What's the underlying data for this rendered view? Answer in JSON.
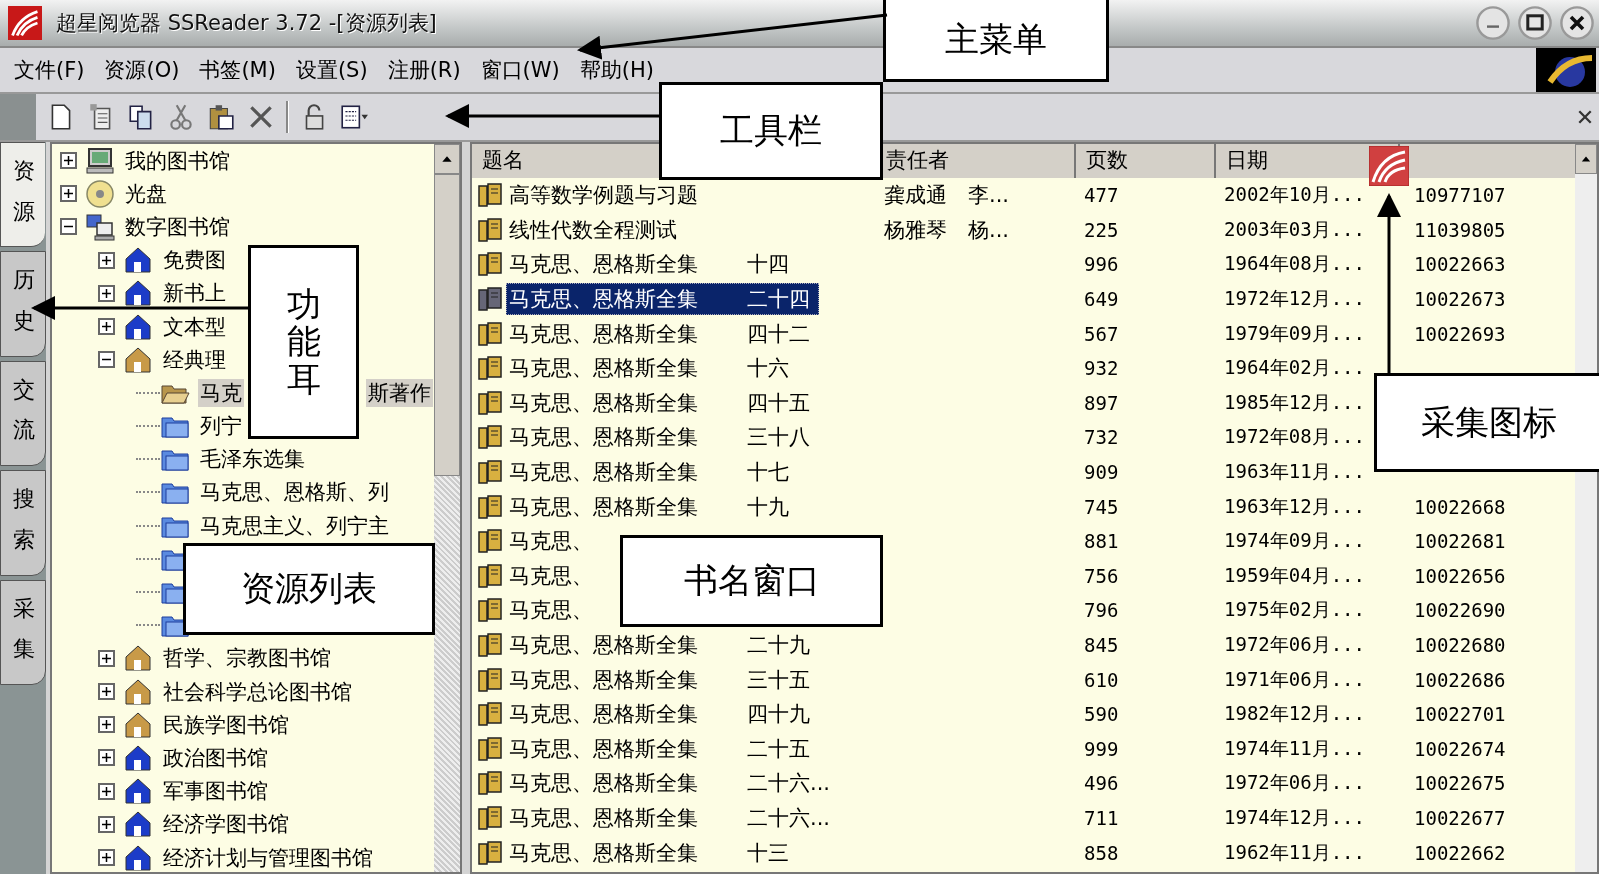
{
  "window": {
    "title": "超星阅览器 SSReader 3.72 -[资源列表]"
  },
  "menu": [
    "文件(F)",
    "资源(O)",
    "书签(M)",
    "设置(S)",
    "注册(R)",
    "窗口(W)",
    "帮助(H)"
  ],
  "side_tabs": [
    {
      "label": "资源",
      "selected": true
    },
    {
      "label": "历史",
      "selected": false
    },
    {
      "label": "交流",
      "selected": false
    },
    {
      "label": "搜索",
      "selected": false
    },
    {
      "label": "采集",
      "selected": false
    }
  ],
  "tree": [
    {
      "label": "我的图书馆",
      "kind": "pc",
      "expanded": false,
      "selected": false
    },
    {
      "label": "光盘",
      "kind": "disc",
      "expanded": false,
      "selected": false
    },
    {
      "label": "数字图书馆",
      "kind": "network",
      "expanded": true,
      "selected": false,
      "children": [
        {
          "label": "免费图",
          "kind": "library",
          "color": "#1c3cc8",
          "expanded": false,
          "selected": false
        },
        {
          "label": "新书上",
          "kind": "library",
          "color": "#1c3cc8",
          "expanded": false,
          "selected": false
        },
        {
          "label": "文本型",
          "kind": "library",
          "color": "#1c3cc8",
          "expanded": false,
          "selected": false
        },
        {
          "label": "经典理",
          "kind": "library",
          "color": "#c89a48",
          "expanded": true,
          "selected": false,
          "children": [
            {
              "label": "马克",
              "tail": "斯著作",
              "kind": "folder-open",
              "selected": true
            },
            {
              "label": "列宁",
              "kind": "folder",
              "selected": false
            },
            {
              "label": "毛泽东选集",
              "kind": "folder",
              "selected": false
            },
            {
              "label": "马克思、恩格斯、列",
              "kind": "folder",
              "selected": false
            },
            {
              "label": "马克思主义、列宁主",
              "kind": "folder",
              "selected": false
            },
            {
              "kind": "folder",
              "selected": false
            },
            {
              "kind": "folder",
              "selected": false
            },
            {
              "kind": "folder",
              "selected": false
            }
          ]
        },
        {
          "label": "哲学、宗教图书馆",
          "kind": "library",
          "color": "#c89a48",
          "expanded": false,
          "selected": false
        },
        {
          "label": "社会科学总论图书馆",
          "kind": "library",
          "color": "#c89a48",
          "expanded": false,
          "selected": false
        },
        {
          "label": "民族学图书馆",
          "kind": "library",
          "color": "#c89a48",
          "expanded": false,
          "selected": false
        },
        {
          "label": "政治图书馆",
          "kind": "library",
          "color": "#1c3cc8",
          "expanded": false,
          "selected": false
        },
        {
          "label": "军事图书馆",
          "kind": "library",
          "color": "#1c3cc8",
          "expanded": false,
          "selected": false
        },
        {
          "label": "经济学图书馆",
          "kind": "library",
          "color": "#1c3cc8",
          "expanded": false,
          "selected": false
        },
        {
          "label": "经济计划与管理图书馆",
          "kind": "library",
          "color": "#1c3cc8",
          "expanded": false,
          "selected": false
        }
      ]
    }
  ],
  "table": {
    "columns": [
      "题名",
      "责任者",
      "页数",
      "日期"
    ],
    "rows": [
      {
        "title": "高等数学例题与习题",
        "author": "龚成通　李...",
        "pages": "477",
        "date": "2002年10月...",
        "id": "10977107",
        "selected": false
      },
      {
        "title": "线性代数全程测试",
        "author": "杨雅琴　杨...",
        "pages": "225",
        "date": "2003年03月...",
        "id": "11039805",
        "selected": false
      },
      {
        "title": "马克思、恩格斯全集",
        "volume": "十四",
        "pages": "996",
        "date": "1964年08月...",
        "id": "10022663",
        "selected": false
      },
      {
        "title": "马克思、恩格斯全集",
        "volume": "二十四",
        "pages": "649",
        "date": "1972年12月...",
        "id": "10022673",
        "selected": true
      },
      {
        "title": "马克思、恩格斯全集",
        "volume": "四十二",
        "pages": "567",
        "date": "1979年09月...",
        "id": "10022693",
        "selected": false
      },
      {
        "title": "马克思、恩格斯全集",
        "volume": "十六",
        "pages": "932",
        "date": "1964年02月...",
        "selected": false
      },
      {
        "title": "马克思、恩格斯全集",
        "volume": "四十五",
        "pages": "897",
        "date": "1985年12月...",
        "selected": false
      },
      {
        "title": "马克思、恩格斯全集",
        "volume": "三十八",
        "pages": "732",
        "date": "1972年08月...",
        "selected": false
      },
      {
        "title": "马克思、恩格斯全集",
        "volume": "十七",
        "pages": "909",
        "date": "1963年11月...",
        "selected": false
      },
      {
        "title": "马克思、恩格斯全集",
        "volume": "十九",
        "pages": "745",
        "date": "1963年12月...",
        "id": "10022668",
        "selected": false
      },
      {
        "title": "马克思、",
        "pages": "881",
        "date": "1974年09月...",
        "id": "10022681",
        "selected": false
      },
      {
        "title": "马克思、",
        "pages": "756",
        "date": "1959年04月...",
        "id": "10022656",
        "selected": false
      },
      {
        "title": "马克思、",
        "pages": "796",
        "date": "1975年02月...",
        "id": "10022690",
        "selected": false
      },
      {
        "title": "马克思、恩格斯全集",
        "volume": "二十九",
        "pages": "845",
        "date": "1972年06月...",
        "id": "10022680",
        "selected": false
      },
      {
        "title": "马克思、恩格斯全集",
        "volume": "三十五",
        "pages": "610",
        "date": "1971年06月...",
        "id": "10022686",
        "selected": false
      },
      {
        "title": "马克思、恩格斯全集",
        "volume": "四十九",
        "pages": "590",
        "date": "1982年12月...",
        "id": "10022701",
        "selected": false
      },
      {
        "title": "马克思、恩格斯全集",
        "volume": "二十五",
        "pages": "999",
        "date": "1974年11月...",
        "id": "10022674",
        "selected": false
      },
      {
        "title": "马克思、恩格斯全集",
        "volume": "二十六...",
        "pages": "496",
        "date": "1972年06月...",
        "id": "10022675",
        "selected": false
      },
      {
        "title": "马克思、恩格斯全集",
        "volume": "二十六...",
        "pages": "711",
        "date": "1974年12月...",
        "id": "10022677",
        "selected": false
      },
      {
        "title": "马克思、恩格斯全集",
        "volume": "十三",
        "pages": "858",
        "date": "1962年11月...",
        "id": "10022662",
        "selected": false
      }
    ]
  },
  "annotations": [
    {
      "label": "主菜单"
    },
    {
      "label": "工具栏"
    },
    {
      "label": "功能耳"
    },
    {
      "label": "资源列表"
    },
    {
      "label": "书名窗口"
    },
    {
      "label": "采集图标"
    }
  ]
}
